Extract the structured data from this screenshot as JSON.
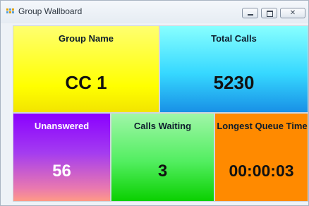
{
  "window": {
    "title": "Group Wallboard"
  },
  "tiles": {
    "group_name": {
      "label": "Group Name",
      "value": "CC 1"
    },
    "total_calls": {
      "label": "Total Calls",
      "value": "5230"
    },
    "unanswered": {
      "label": "Unanswered",
      "value": "56"
    },
    "calls_waiting": {
      "label": "Calls Waiting",
      "value": "3"
    },
    "longest_queue_time": {
      "label": "Longest Queue Time",
      "value": "00:00:03"
    }
  },
  "colors": {
    "group_name_bg": "#ffff00",
    "total_calls_bg": "#36d8ff",
    "unanswered_bg": "#8a00ff",
    "calls_waiting_bg": "#52ee60",
    "longest_queue_time_bg": "#ff8a00"
  }
}
